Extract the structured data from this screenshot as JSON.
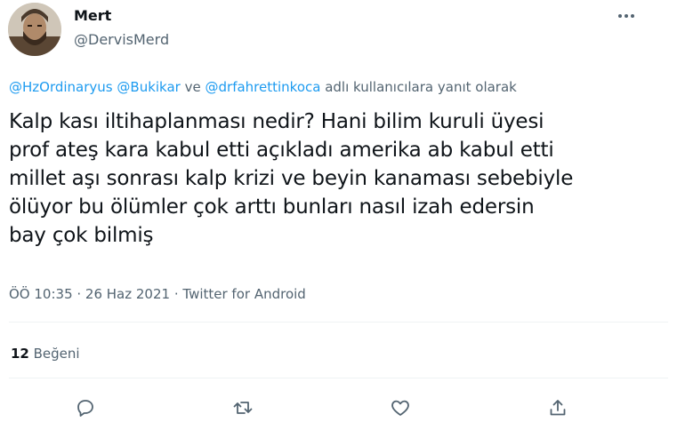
{
  "tweet": {
    "author_name": "Mert",
    "author_handle": "@DervisMerd",
    "reply_to": {
      "mention_1": "@HzOrdinaryus",
      "mention_2": "@Bukikar",
      "connector": " ve ",
      "mention_3": "@drfahrettinkoca",
      "suffix": " adlı kullanıcılara yanıt olarak"
    },
    "text_lines": [
      "Kalp kası iltihaplanması nedir? Hani bilim kuruli üyesi",
      "prof ateş kara kabul etti açıkladı amerika ab kabul etti",
      "millet aşı sonrası kalp krizi ve beyin kanaması sebebiyle",
      "ölüyor bu ölümler çok arttı bunları nasıl izah edersin",
      "bay çok bilmiş"
    ],
    "time": "ÖÖ 10:35",
    "date": "26 Haz 2021",
    "source": "Twitter for Android",
    "separator": " · ",
    "like_count": "12",
    "like_label": " Beğeni"
  },
  "icons": {
    "more": "more-horizontal-icon",
    "reply": "reply-icon",
    "retweet": "retweet-icon",
    "like": "heart-icon",
    "share": "share-icon"
  },
  "colors": {
    "link": "#1d9bf0",
    "secondary_text": "#536471",
    "primary_text": "#0f1419",
    "divider": "#eff3f4"
  }
}
